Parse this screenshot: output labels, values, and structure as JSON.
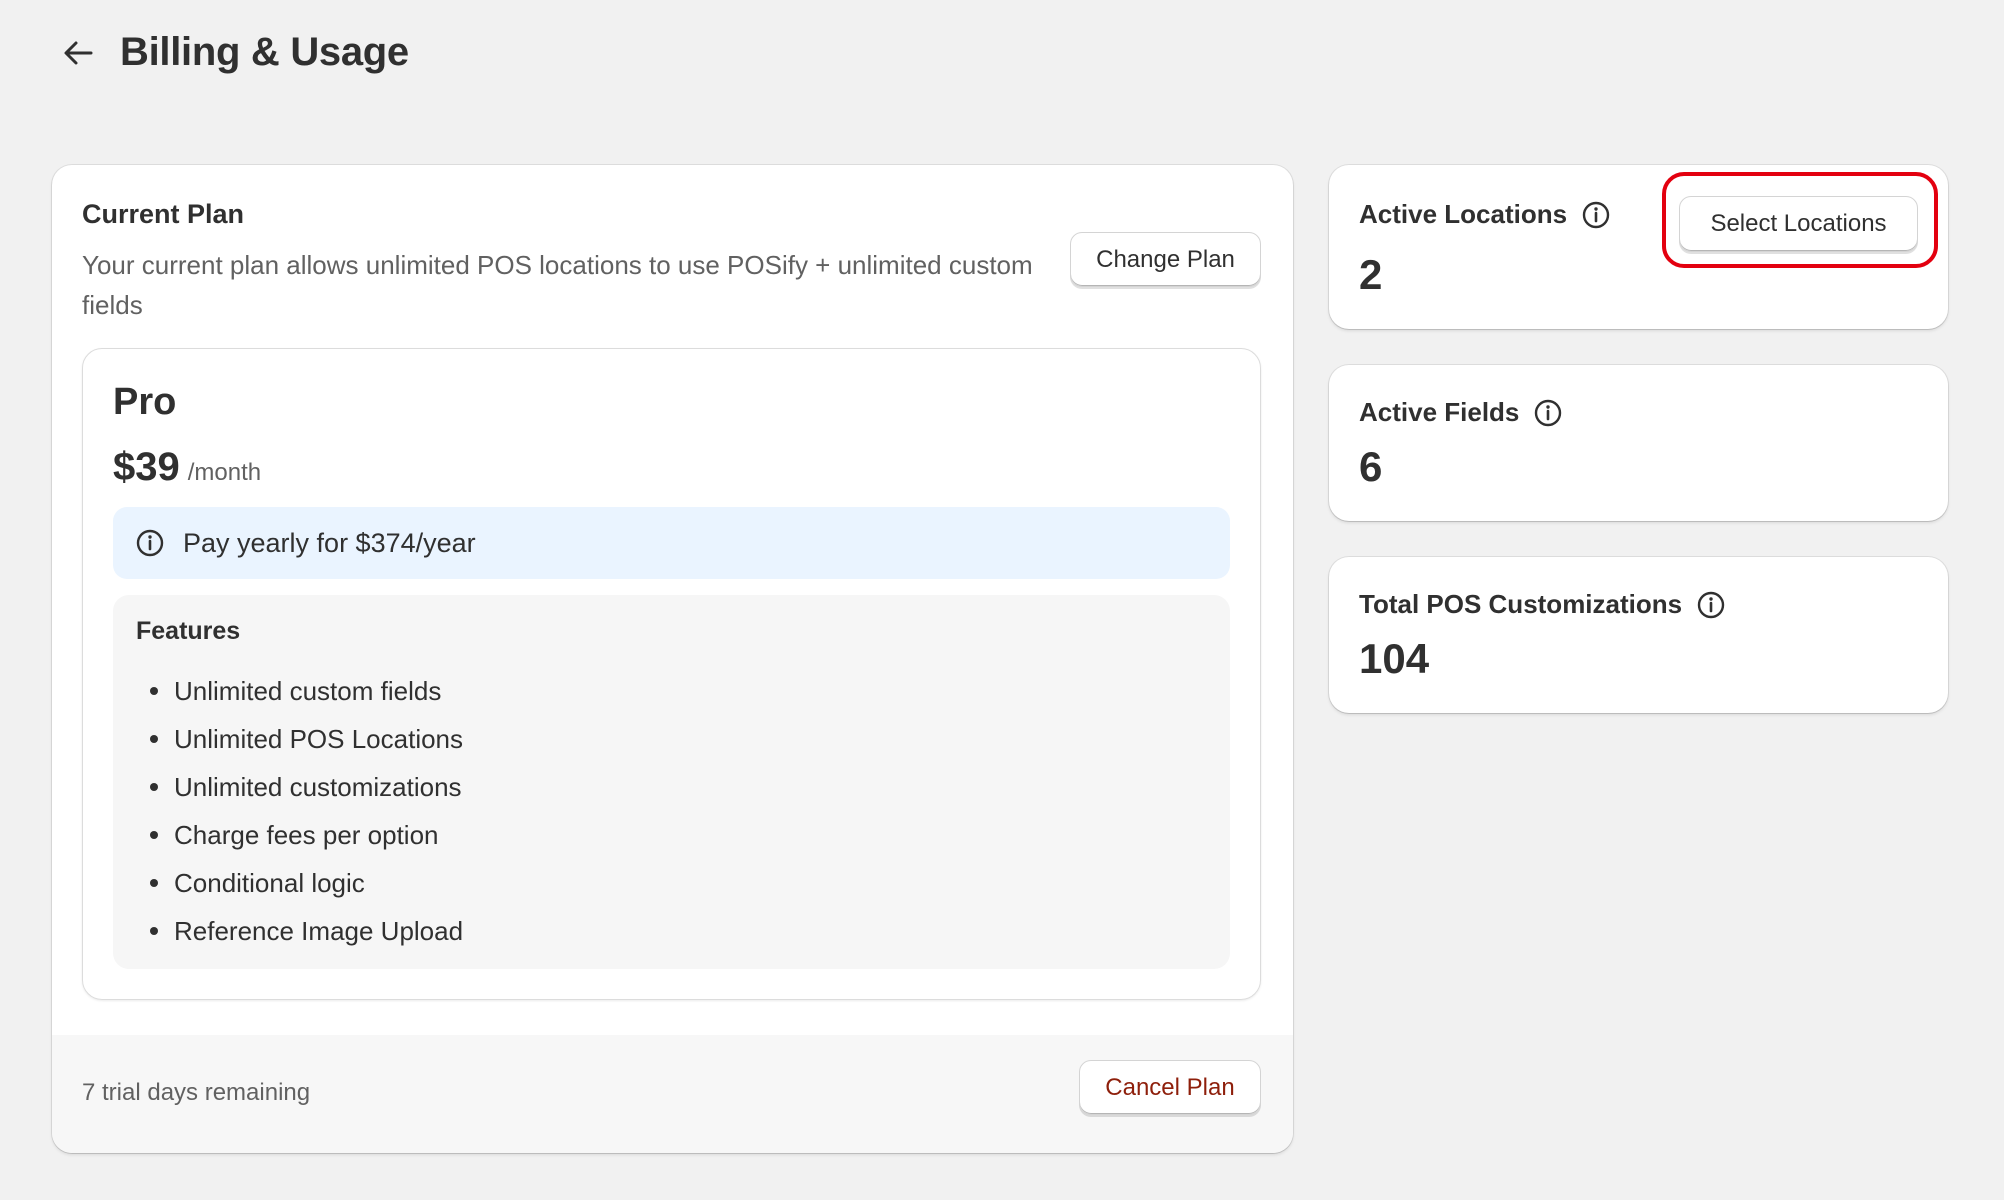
{
  "header": {
    "back_icon": "arrow-left-icon",
    "title": "Billing & Usage"
  },
  "current_plan": {
    "heading": "Current Plan",
    "description": "Your current plan allows unlimited POS locations to use POSify + unlimited custom fields",
    "change_plan_label": "Change Plan",
    "plan": {
      "name": "Pro",
      "price": "$39",
      "period": "/month",
      "yearly_banner": "Pay yearly for $374/year",
      "features_title": "Features",
      "features": [
        "Unlimited custom fields",
        "Unlimited POS Locations",
        "Unlimited customizations",
        "Charge fees per option",
        "Conditional logic",
        "Reference Image Upload"
      ]
    },
    "footer": {
      "trial_text": "7 trial days remaining",
      "cancel_label": "Cancel Plan"
    }
  },
  "metrics": {
    "active_locations": {
      "label": "Active Locations",
      "value": "2",
      "button_label": "Select Locations"
    },
    "active_fields": {
      "label": "Active Fields",
      "value": "6"
    },
    "total_customizations": {
      "label": "Total POS Customizations",
      "value": "104"
    }
  },
  "colors": {
    "page_bg": "#f1f1f1",
    "card_bg": "#ffffff",
    "text": "#303030",
    "subdued_text": "#616161",
    "banner_bg": "#eaf4ff",
    "critical_text": "#8e1f0b",
    "highlight": "#e3000f"
  }
}
